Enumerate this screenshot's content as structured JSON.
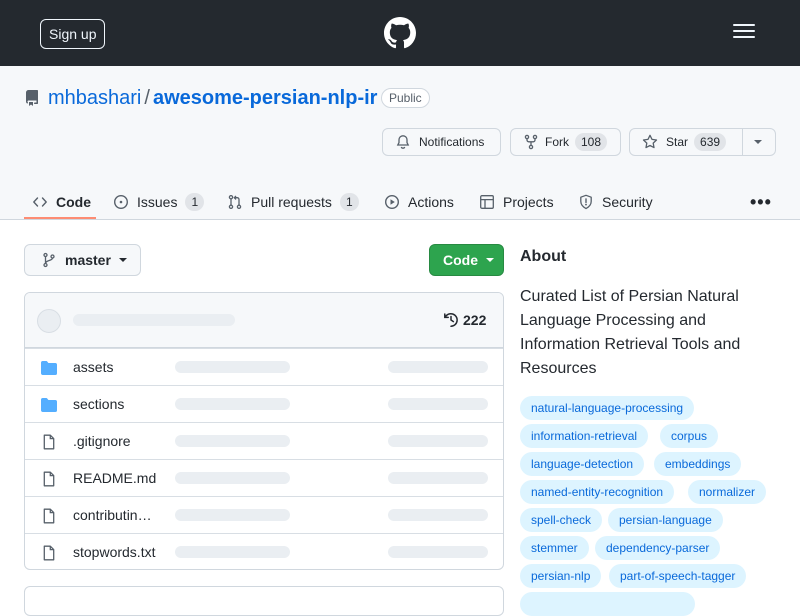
{
  "header": {
    "signup_label": "Sign up",
    "logo_icon": "github-mark-icon",
    "menu_icon": "hamburger-icon"
  },
  "repo": {
    "owner": "mhbashari",
    "separator": "/",
    "name": "awesome-persian-nlp-ir",
    "visibility": "Public",
    "notifications_label": "Notifications",
    "fork_label": "Fork",
    "fork_count": "108",
    "star_label": "Star",
    "star_count": "639"
  },
  "tabs": [
    {
      "label": "Code",
      "icon": "code-icon",
      "selected": true
    },
    {
      "label": "Issues",
      "icon": "issue-icon",
      "count": "1"
    },
    {
      "label": "Pull requests",
      "icon": "pull-request-icon",
      "count": "1"
    },
    {
      "label": "Actions",
      "icon": "play-icon"
    },
    {
      "label": "Projects",
      "icon": "table-icon"
    },
    {
      "label": "Security",
      "icon": "shield-icon"
    }
  ],
  "more_label": "•••",
  "branch": {
    "label": "master",
    "icon": "git-branch-icon"
  },
  "code_button_label": "Code",
  "files": {
    "commit_count": "222",
    "history_icon": "history-icon",
    "items": [
      {
        "name": "assets",
        "type": "folder"
      },
      {
        "name": "sections",
        "type": "folder"
      },
      {
        "name": ".gitignore",
        "type": "file"
      },
      {
        "name": "README.md",
        "type": "file"
      },
      {
        "name": "contributin…",
        "type": "file"
      },
      {
        "name": "stopwords.txt",
        "type": "file"
      }
    ]
  },
  "about": {
    "title": "About",
    "description": "Curated List of Persian Natural Language Processing and Information Retrieval Tools and Resources",
    "topics": [
      "natural-language-processing",
      "information-retrieval",
      "corpus",
      "language-detection",
      "embeddings",
      "named-entity-recognition",
      "normalizer",
      "spell-check",
      "persian-language",
      "stemmer",
      "dependency-parser",
      "persian-nlp",
      "part-of-speech-tagger"
    ]
  },
  "colors": {
    "header_bg": "#24292f",
    "link": "#0969da",
    "code_button": "#2da44e",
    "tab_underline": "#fd8c73",
    "topic_bg": "#ddf4ff"
  }
}
